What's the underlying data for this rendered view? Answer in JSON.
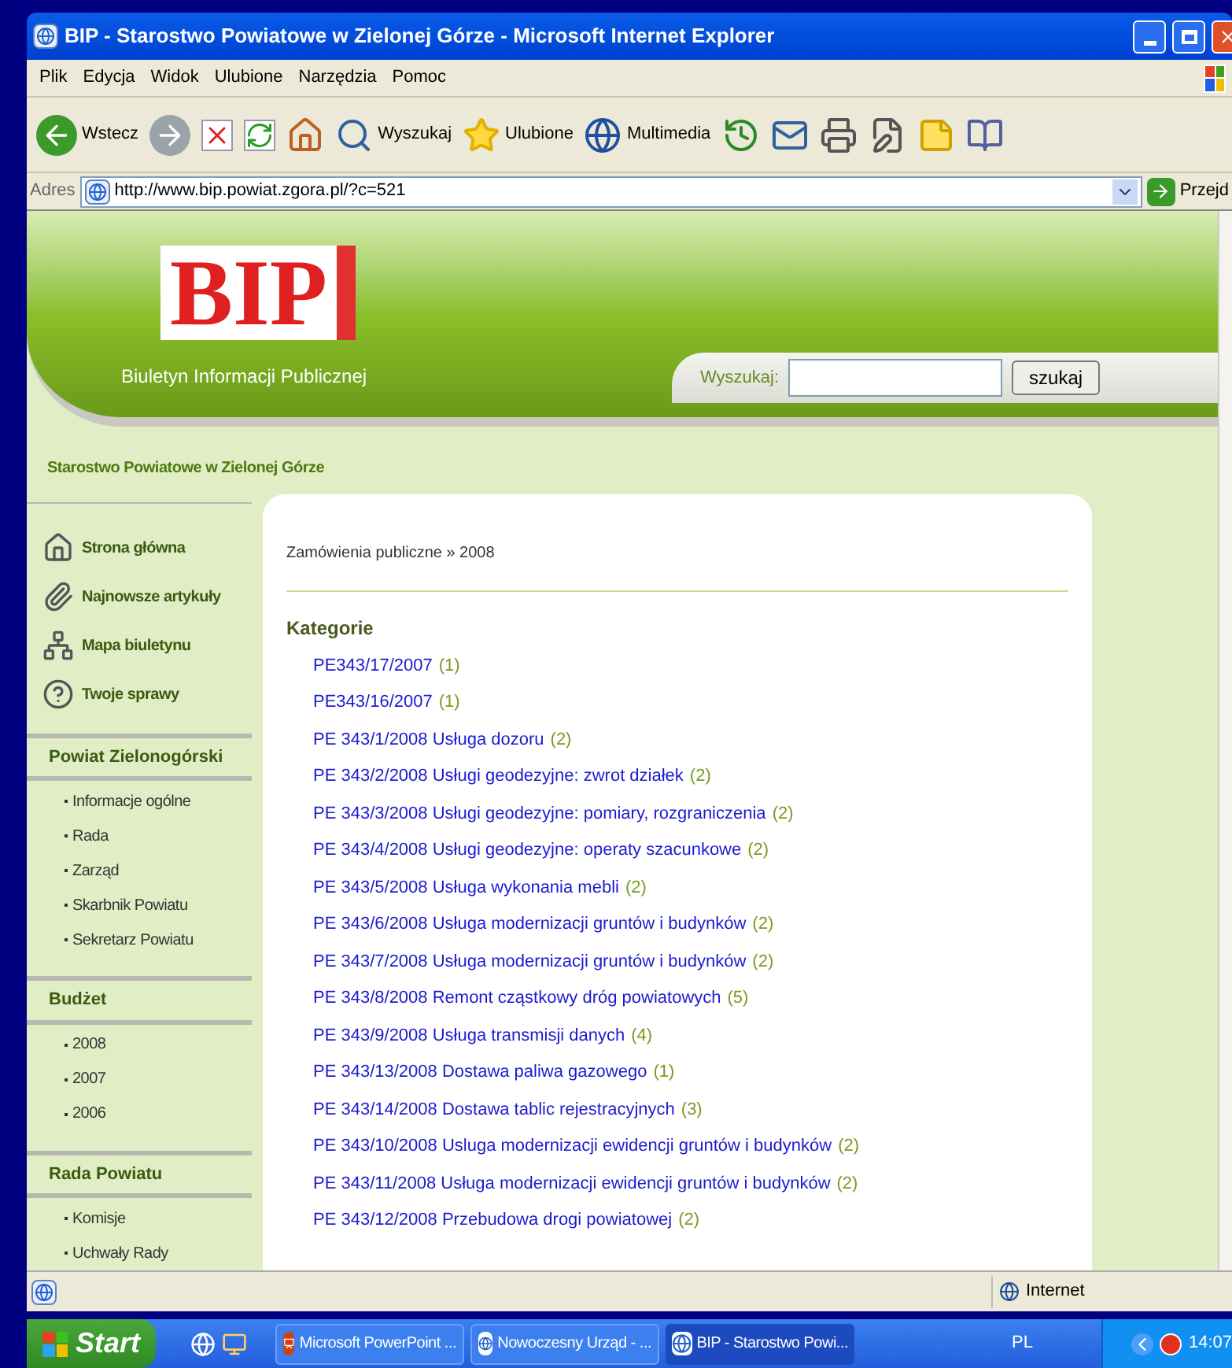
{
  "window": {
    "title": "BIP - Starostwo Powiatowe w Zielonej Górze - Microsoft Internet Explorer"
  },
  "menu": [
    "Plik",
    "Edycja",
    "Widok",
    "Ulubione",
    "Narzędzia",
    "Pomoc"
  ],
  "toolbar": [
    {
      "kind": "back",
      "label": "Wstecz"
    },
    {
      "kind": "forward"
    },
    {
      "kind": "stop"
    },
    {
      "kind": "refresh"
    },
    {
      "kind": "home"
    },
    {
      "kind": "search",
      "label": "Wyszukaj"
    },
    {
      "kind": "favorites",
      "label": "Ulubione"
    },
    {
      "kind": "media",
      "label": "Multimedia"
    },
    {
      "kind": "history"
    },
    {
      "kind": "mail"
    },
    {
      "kind": "print"
    },
    {
      "kind": "edit"
    },
    {
      "kind": "note"
    },
    {
      "kind": "research"
    }
  ],
  "address": {
    "label": "Adres",
    "url": "http://www.bip.powiat.zgora.pl/?c=521",
    "go": "Przejd"
  },
  "header": {
    "logo": "BIP",
    "subtitle": "Biuletyn Informacji Publicznej",
    "search_label": "Wyszukaj:",
    "search_button": "szukaj"
  },
  "sidebar": {
    "site_title": "Starostwo Powiatowe w Zielonej Górze",
    "nav": [
      {
        "kind": "home",
        "label": "Strona główna"
      },
      {
        "kind": "articles",
        "label": "Najnowsze artykuły"
      },
      {
        "kind": "map",
        "label": "Mapa biuletynu"
      },
      {
        "kind": "help",
        "label": "Twoje sprawy"
      }
    ],
    "sections": [
      {
        "title": "Powiat Zielonogórski",
        "items": [
          "Informacje ogólne",
          "Rada",
          "Zarząd",
          "Skarbnik Powiatu",
          "Sekretarz Powiatu"
        ]
      },
      {
        "title": "Budżet",
        "items": [
          "2008",
          "2007",
          "2006"
        ]
      },
      {
        "title": "Rada Powiatu",
        "items": [
          "Komisje",
          "Uchwały Rady"
        ]
      }
    ]
  },
  "content": {
    "breadcrumb": "Zamówienia publiczne » 2008",
    "heading": "Kategorie",
    "categories": [
      {
        "name": "PE343/17/2007",
        "count": "(1)"
      },
      {
        "name": "PE343/16/2007",
        "count": "(1)"
      },
      {
        "name": "PE 343/1/2008 Usługa dozoru",
        "count": "(2)"
      },
      {
        "name": "PE 343/2/2008 Usługi geodezyjne: zwrot działek",
        "count": "(2)"
      },
      {
        "name": "PE 343/3/2008 Usługi geodezyjne: pomiary, rozgraniczenia",
        "count": "(2)"
      },
      {
        "name": "PE 343/4/2008 Usługi geodezyjne: operaty szacunkowe",
        "count": "(2)"
      },
      {
        "name": "PE 343/5/2008 Usługa wykonania mebli",
        "count": "(2)"
      },
      {
        "name": "PE 343/6/2008 Usługa modernizacji gruntów i budynków",
        "count": "(2)"
      },
      {
        "name": "PE 343/7/2008 Usługa modernizacji gruntów i budynków",
        "count": "(2)"
      },
      {
        "name": "PE 343/8/2008 Remont cząstkowy dróg powiatowych",
        "count": "(5)"
      },
      {
        "name": "PE 343/9/2008 Usługa transmisji danych",
        "count": "(4)"
      },
      {
        "name": "PE 343/13/2008 Dostawa paliwa gazowego",
        "count": "(1)"
      },
      {
        "name": "PE 343/14/2008 Dostawa tablic rejestracyjnych",
        "count": "(3)"
      },
      {
        "name": "PE 343/10/2008 Usluga modernizacji ewidencji gruntów i budynków",
        "count": "(2)"
      },
      {
        "name": "PE 343/11/2008 Usługa modernizacji ewidencji gruntów i budynków",
        "count": "(2)"
      },
      {
        "name": "PE 343/12/2008 Przebudowa drogi powiatowej",
        "count": "(2)"
      }
    ]
  },
  "status_bar": {
    "zone": "Internet"
  },
  "taskbar": {
    "start": "Start",
    "tasks": [
      {
        "label": "Microsoft PowerPoint ...",
        "kind": "powerpoint",
        "selected": false
      },
      {
        "label": "Nowoczesny Urząd - ...",
        "kind": "ie",
        "selected": false
      },
      {
        "label": "BIP - Starostwo Powi...",
        "kind": "ie",
        "selected": true
      }
    ],
    "language": "PL",
    "clock": "14:07"
  }
}
